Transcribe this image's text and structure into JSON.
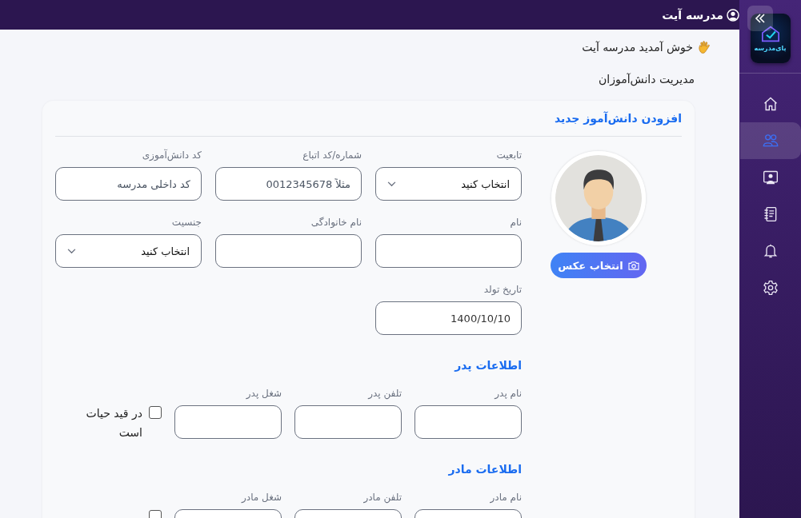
{
  "topbar": {
    "school_name": "مدرسه آیت"
  },
  "sidebar": {
    "logo_text": "پای‌مدرسه",
    "items": [
      {
        "kind": "home",
        "selected": false
      },
      {
        "kind": "users",
        "selected": true
      },
      {
        "kind": "teacher",
        "selected": false
      },
      {
        "kind": "notebook",
        "selected": false
      },
      {
        "kind": "bell",
        "selected": false
      },
      {
        "kind": "gear",
        "selected": false
      }
    ]
  },
  "welcome": "خوش آمدید مدرسه آیت",
  "page_title": "مدیریت دانش‌آموزان",
  "form": {
    "title": "افزودن دانش‌آموز جدید",
    "photo_button": "انتخاب عکس",
    "fields": [
      {
        "kind": "select",
        "label": "تابعیت",
        "value": "انتخاب کنید"
      },
      {
        "kind": "text",
        "label": "شماره/کد اتباع",
        "placeholder": "مثلاً 0012345678"
      },
      {
        "kind": "text",
        "label": "کد دانش‌آموزی",
        "placeholder": "کد داخلی مدرسه"
      },
      {
        "kind": "text",
        "label": "نام"
      },
      {
        "kind": "text",
        "label": "نام خانوادگی"
      },
      {
        "kind": "select",
        "label": "جنسیت",
        "value": "انتخاب کنید"
      },
      {
        "kind": "text",
        "label": "تاریخ تولد",
        "value": "1400/10/10"
      }
    ],
    "sections": [
      {
        "title": "اطلاعات پدر",
        "fields": [
          {
            "label": "نام پدر"
          },
          {
            "label": "تلفن پدر"
          },
          {
            "label": "شغل پدر"
          }
        ],
        "alive": {
          "label": "در قید حیات است",
          "checked": false
        }
      },
      {
        "title": "اطلاعات مادر",
        "fields": [
          {
            "label": "نام مادر"
          },
          {
            "label": "تلفن مادر"
          },
          {
            "label": "شغل مادر"
          }
        ],
        "alive": {
          "checked": false
        }
      }
    ]
  }
}
